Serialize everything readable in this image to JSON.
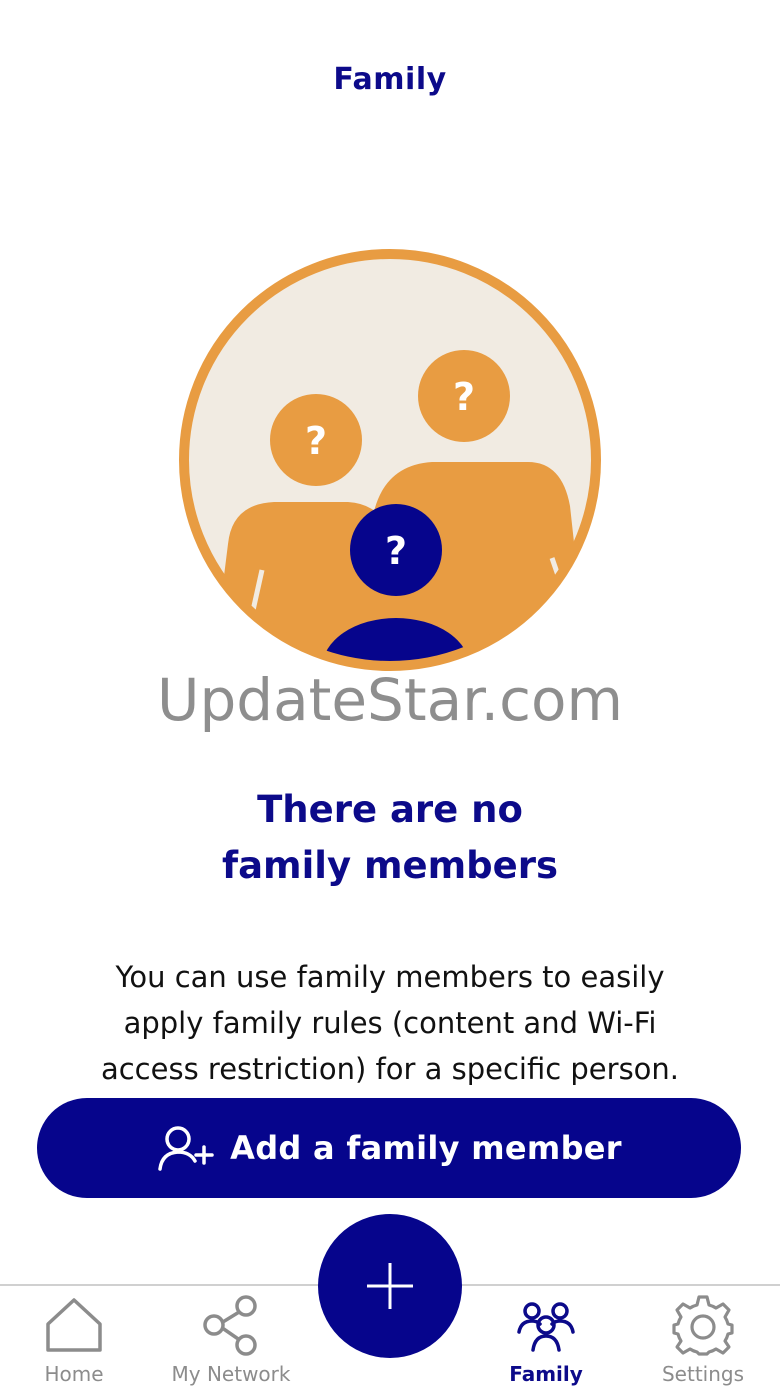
{
  "header": {
    "title": "Family"
  },
  "illustration": {
    "icon": "unknown-family-members-illustration",
    "question_mark": "?",
    "colors": {
      "ring": "#e89c42",
      "background": "#f1ebe2",
      "figure": "#e89c42",
      "accent_figure": "#06058c"
    }
  },
  "watermark": {
    "text": "UpdateStar.com"
  },
  "empty_state": {
    "title_line1": "There are no",
    "title_line2": "family members",
    "description_line1": "You can use family members to easily",
    "description_line2": "apply family rules (content and Wi-Fi",
    "description_line3": "access restriction) for a specific person."
  },
  "actions": {
    "add_member_label": "Add a family member",
    "add_member_icon": "add-person-icon",
    "fab_icon": "plus-icon"
  },
  "tab_bar": {
    "active": "Family",
    "items": [
      {
        "label": "Home",
        "icon": "home-icon"
      },
      {
        "label": "My Network",
        "icon": "share-network-icon"
      },
      {
        "label": "Family",
        "icon": "family-icon"
      },
      {
        "label": "Settings",
        "icon": "gear-icon"
      }
    ]
  },
  "colors": {
    "brand": "#06058c",
    "title": "#0c0a8a",
    "tab_inactive": "#8c8c8c",
    "accent_orange": "#e89c42"
  }
}
